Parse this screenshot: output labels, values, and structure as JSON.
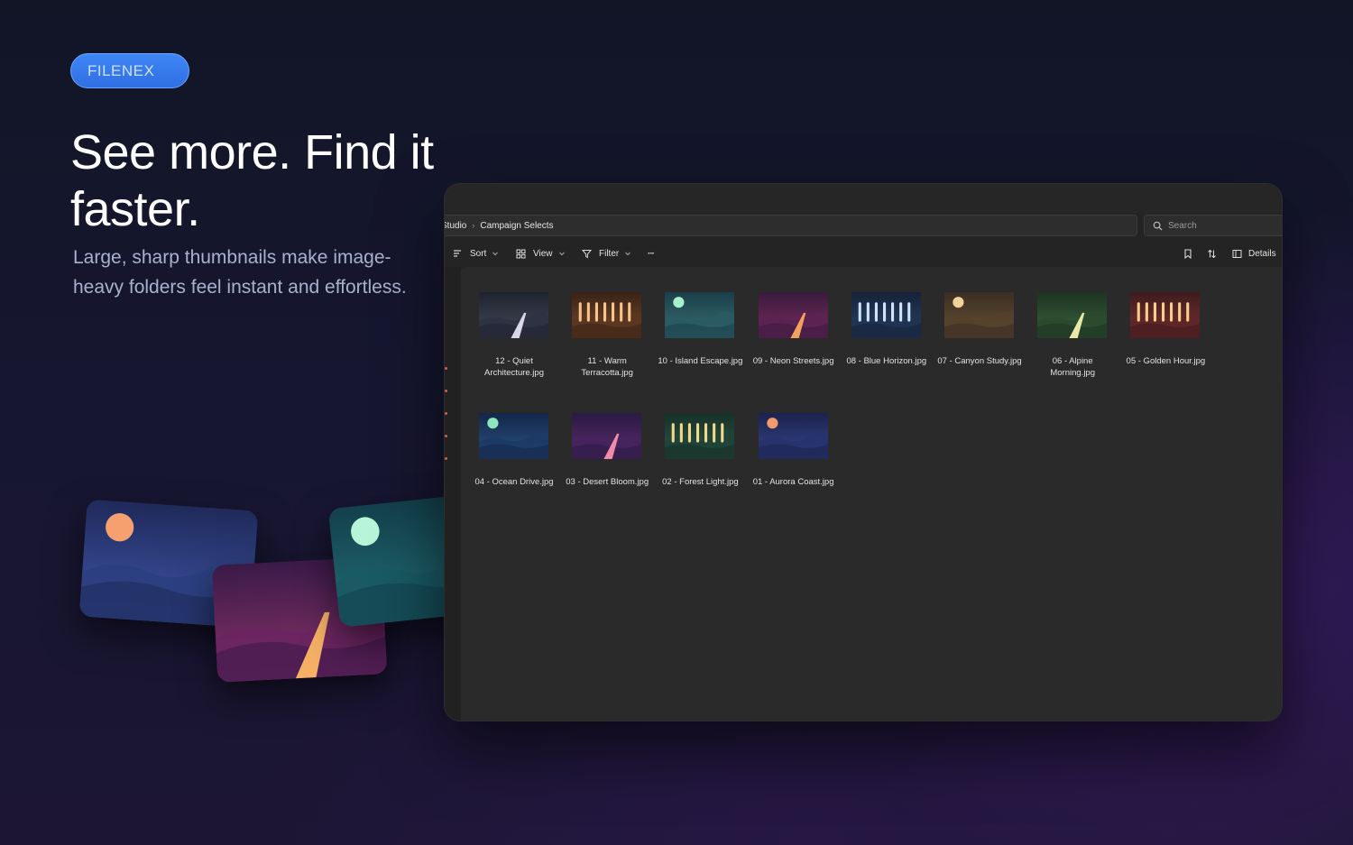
{
  "hero": {
    "brand": "FILENEX",
    "headline": "See more. Find it faster.",
    "subline": "Large, sharp thumbnails make image-heavy folders feel instant and effortless."
  },
  "window": {
    "breadcrumb": [
      "Studio",
      "Campaign Selects"
    ],
    "search_placeholder": "Search",
    "toolbar": {
      "sort": "Sort",
      "view": "View",
      "filter": "Filter",
      "more": "···",
      "details": "Details"
    },
    "files": [
      {
        "name": "12 - Quiet Architecture.jpg",
        "art": "road",
        "colors": [
          "#1f2330",
          "#2d3242",
          "#454a58"
        ],
        "accent": "#d8d8e8"
      },
      {
        "name": "11 - Warm Terracotta.jpg",
        "art": "bars",
        "colors": [
          "#3a2216",
          "#5a3520",
          "#7a4a2c"
        ],
        "accent": "#f5c58a"
      },
      {
        "name": "10 - Island Escape.jpg",
        "art": "sun",
        "colors": [
          "#1b3f4a",
          "#2a5b63",
          "#3b7074"
        ],
        "accent": "#a7f0cf"
      },
      {
        "name": "09 - Neon Streets.jpg",
        "art": "road",
        "colors": [
          "#3a1a3e",
          "#5b2452",
          "#7a2d5e"
        ],
        "accent": "#f3a15c"
      },
      {
        "name": "08 - Blue Horizon.jpg",
        "art": "bars",
        "colors": [
          "#16223a",
          "#1f3352",
          "#2a4566"
        ],
        "accent": "#cfe3ff"
      },
      {
        "name": "07 - Canyon Study.jpg",
        "art": "sun",
        "colors": [
          "#3a2e22",
          "#55402c",
          "#6a5236"
        ],
        "accent": "#f2d39a"
      },
      {
        "name": "06 - Alpine Morning.jpg",
        "art": "road",
        "colors": [
          "#1d3322",
          "#2b4a2e",
          "#3d6440"
        ],
        "accent": "#e8e8a8"
      },
      {
        "name": "05 - Golden Hour.jpg",
        "art": "bars",
        "colors": [
          "#3f1a1e",
          "#5e2628",
          "#7c3434"
        ],
        "accent": "#f7cf8a"
      },
      {
        "name": "04 - Ocean Drive.jpg",
        "art": "sun",
        "colors": [
          "#14264a",
          "#1d3a66",
          "#2a5482"
        ],
        "accent": "#8fe6be"
      },
      {
        "name": "03 - Desert Bloom.jpg",
        "art": "road",
        "colors": [
          "#2a1a44",
          "#45235c",
          "#5e2c6c"
        ],
        "accent": "#f08aa8"
      },
      {
        "name": "02 - Forest Light.jpg",
        "art": "bars",
        "colors": [
          "#173028",
          "#204238",
          "#2c5a48"
        ],
        "accent": "#f2d88a"
      },
      {
        "name": "01 - Aurora Coast.jpg",
        "art": "sun",
        "colors": [
          "#1c2250",
          "#27336c",
          "#34478a"
        ],
        "accent": "#f29a6a"
      }
    ]
  },
  "cards": [
    {
      "art": "sun",
      "colors": [
        "#1f2a5a",
        "#2b3f80",
        "#3f55a8"
      ],
      "accent": "#f5a06e"
    },
    {
      "art": "road",
      "colors": [
        "#3a1a48",
        "#6a2560",
        "#8a3468"
      ],
      "accent": "#f5b066"
    },
    {
      "art": "sun",
      "colors": [
        "#13404c",
        "#1a5a64",
        "#227078"
      ],
      "accent": "#b8f5d8"
    }
  ]
}
